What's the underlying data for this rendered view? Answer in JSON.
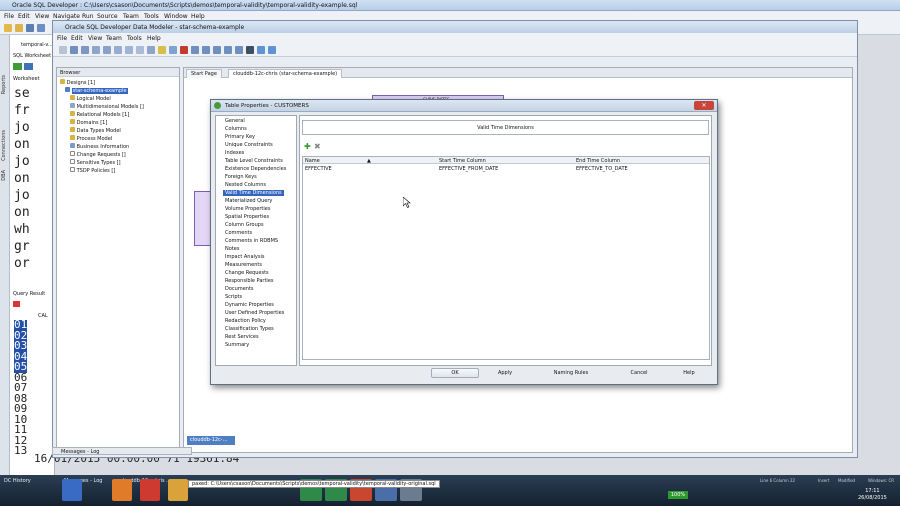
{
  "outer": {
    "title": "Oracle SQL Developer : C:\\Users\\csason\\Documents\\Scripts\\demos\\temporal-validity\\temporal-validity-example.sql",
    "menu": [
      "File",
      "Edit",
      "View",
      "Navigate",
      "Run",
      "Source",
      "Team",
      "Tools",
      "Window",
      "Help"
    ],
    "left_tabs": [
      "Reports",
      "Connections",
      "DBA"
    ],
    "worksheet_tab": "temporal-v...",
    "worksheet_label": "SQL Worksheet",
    "worksheet_sub": "Worksheet",
    "query_results": "Query Result",
    "code_lines": [
      "se",
      "fr",
      "jo",
      "on",
      "jo",
      "on",
      "jo",
      "on",
      "wh",
      "gr",
      "or"
    ],
    "line_numbers": [
      "01",
      "02",
      "03",
      "04",
      "05",
      "06",
      "07",
      "08",
      "09",
      "10",
      "11",
      "12",
      "13",
      "14"
    ],
    "bottom_rows": [
      "16/01/2015 00:00:00    71 19361.84"
    ],
    "col_header": "CAL"
  },
  "dm": {
    "title": "Oracle SQL Developer Data Modeler - star-schema-example",
    "menu": [
      "File",
      "Edit",
      "View",
      "Team",
      "Tools",
      "Help"
    ],
    "browser_title": "Browser",
    "tree": [
      {
        "label": "Designs [1]",
        "depth": 0
      },
      {
        "label": "star-schema-example",
        "depth": 1,
        "selected": true
      },
      {
        "label": "Logical Model",
        "depth": 2
      },
      {
        "label": "Multidimensional Models []",
        "depth": 2
      },
      {
        "label": "Relational Models [1]",
        "depth": 2
      },
      {
        "label": "Domains [1]",
        "depth": 2
      },
      {
        "label": "Data Types Model",
        "depth": 2
      },
      {
        "label": "Process Model",
        "depth": 2
      },
      {
        "label": "Business Information",
        "depth": 2
      },
      {
        "label": "Change Requests []",
        "depth": 2
      },
      {
        "label": "Sensitive Types []",
        "depth": 2
      },
      {
        "label": "TSDP Policies []",
        "depth": 2
      }
    ],
    "tabs": [
      "Start Page",
      "clouddb-12c-chris (star-schema-example)"
    ],
    "bottom_tab": "clouddb-12c-...",
    "canvas_entity": "CHRIS.DATES",
    "messages": "Messages - Log"
  },
  "dialog": {
    "title": "Table Properties - CUSTOMERS",
    "nav": [
      "General",
      "Columns",
      "Primary Key",
      "Unique Constraints",
      "Indexes",
      "Table Level Constraints",
      "Existence Dependencies",
      "Foreign Keys",
      "Nested Columns",
      "Valid Time Dimensions",
      "Materialized Query",
      "Volume Properties",
      "Spatial Properties",
      "Column Groups",
      "Comments",
      "Comments in RDBMS",
      "Notes",
      "Impact Analysis",
      "Measurements",
      "Change Requests",
      "Responsible Parties",
      "Documents",
      "Scripts",
      "Dynamic Properties",
      "User Defined Properties",
      "Redaction Policy",
      "Classification Types",
      "Rest Services",
      "Summary"
    ],
    "selected_nav": "Valid Time Dimensions",
    "section_title": "Valid Time Dimensions",
    "columns": [
      "Name",
      "Start Time Column",
      "End Time Column"
    ],
    "rows": [
      [
        "EFFECTIVE",
        "EFFECTIVE_FROM_DATE",
        "EFFECTIVE_TO_DATE"
      ]
    ],
    "buttons": {
      "ok": "OK",
      "apply": "Apply",
      "naming": "Naming Rules",
      "cancel": "Cancel",
      "help": "Help"
    }
  },
  "taskbar": {
    "path": "paxed: C:\\Users\\csason\\Documents\\Scripts\\demos\\temporal-validity\\temporal-validity-original.sql",
    "time": "17:11",
    "date": "26/08/2015",
    "battery": "100%",
    "status": [
      "Line 6 Column 22",
      "Insert",
      "Modified",
      "Windows: CR"
    ],
    "tasks": [
      "DC History",
      "Messages - Log",
      "clouddb-12c-chris ..."
    ]
  },
  "colors": {
    "selection": "#3466c0",
    "title_gradient": "#c4d3e5",
    "taskbar": "#1c2b3c"
  }
}
